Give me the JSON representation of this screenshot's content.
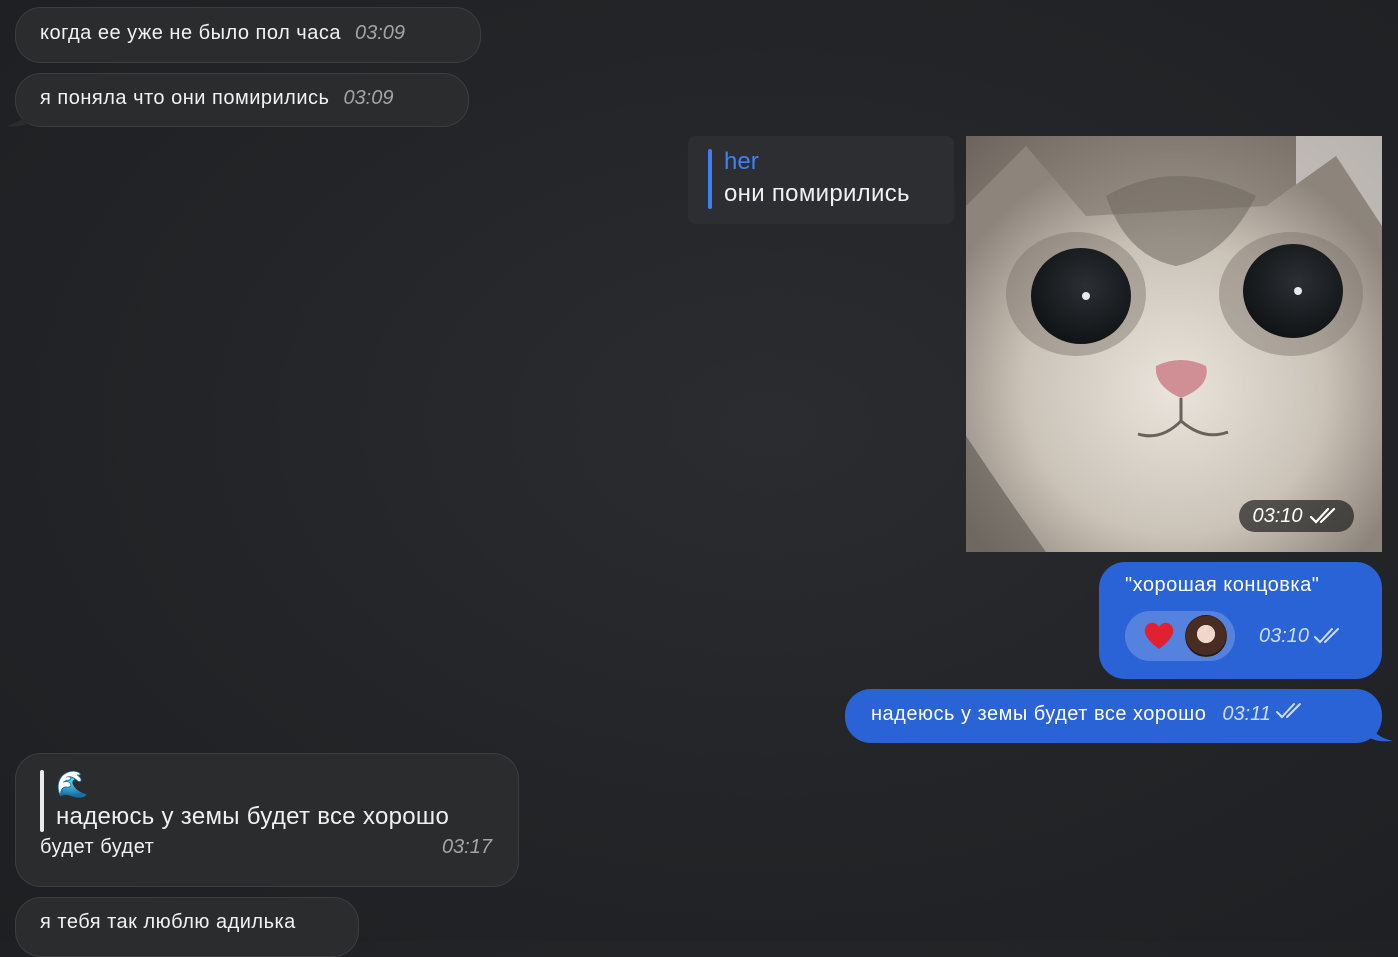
{
  "messages": {
    "m1": {
      "text": "когда ее уже не было пол часа",
      "time": "03:09"
    },
    "m2": {
      "text": "я поняла что они помирились",
      "time": "03:09"
    },
    "m3": {
      "reply_author": "her",
      "reply_text": "они помирились",
      "time": "03:10"
    },
    "m4": {
      "text": "\"хорошая концовка\"",
      "reaction": "heart-emoji",
      "time": "03:10"
    },
    "m5": {
      "text": "надеюсь у земы будет все хорошо",
      "time": "03:11"
    },
    "m6": {
      "quote_emoji": "🌊",
      "quote_text": "надеюсь у земы будет все хорошо",
      "text": "будет будет",
      "time": "03:17"
    },
    "m7": {
      "text": "я тебя так люблю адилька"
    }
  },
  "colors": {
    "background": "#222427",
    "incoming_bubble": "#2b2c2e",
    "outgoing_bubble": "#2a63d6",
    "reply_accent": "#3d7ef5",
    "reaction_heart": "#e3202f"
  }
}
